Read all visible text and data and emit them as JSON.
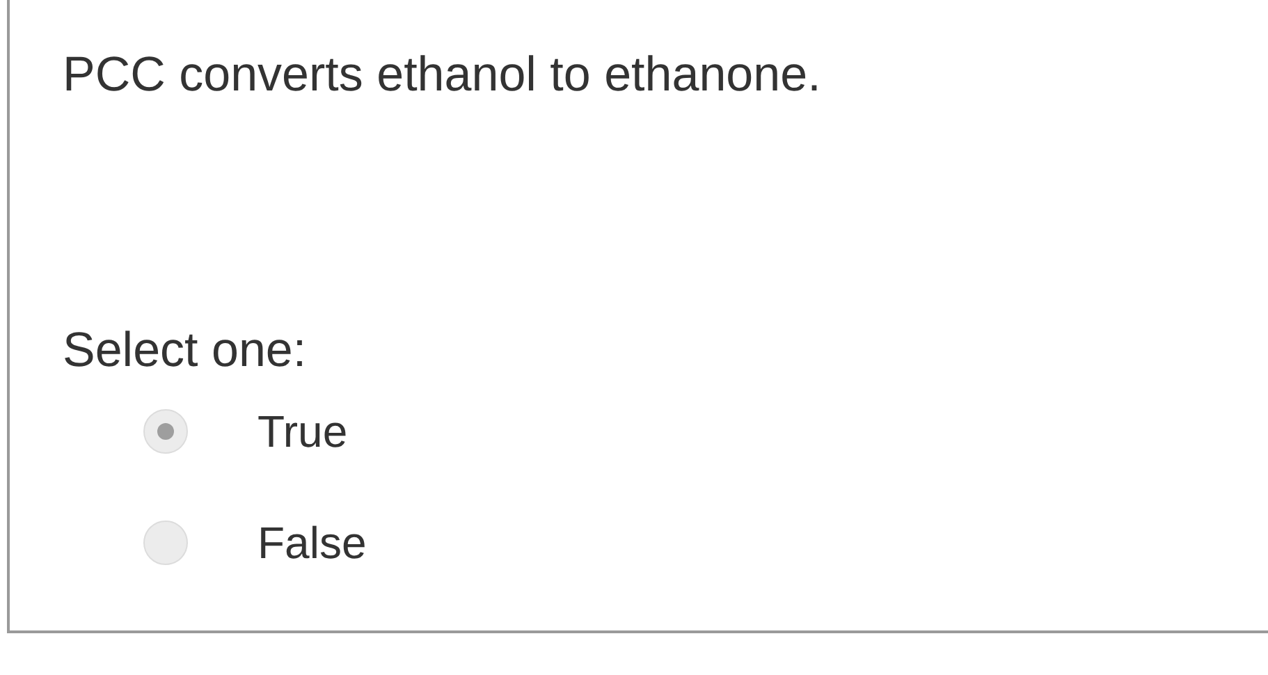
{
  "question": {
    "text": "PCC converts ethanol to ethanone.",
    "prompt": "Select one:",
    "options": [
      {
        "label": "True",
        "selected": true
      },
      {
        "label": "False",
        "selected": false
      }
    ]
  }
}
